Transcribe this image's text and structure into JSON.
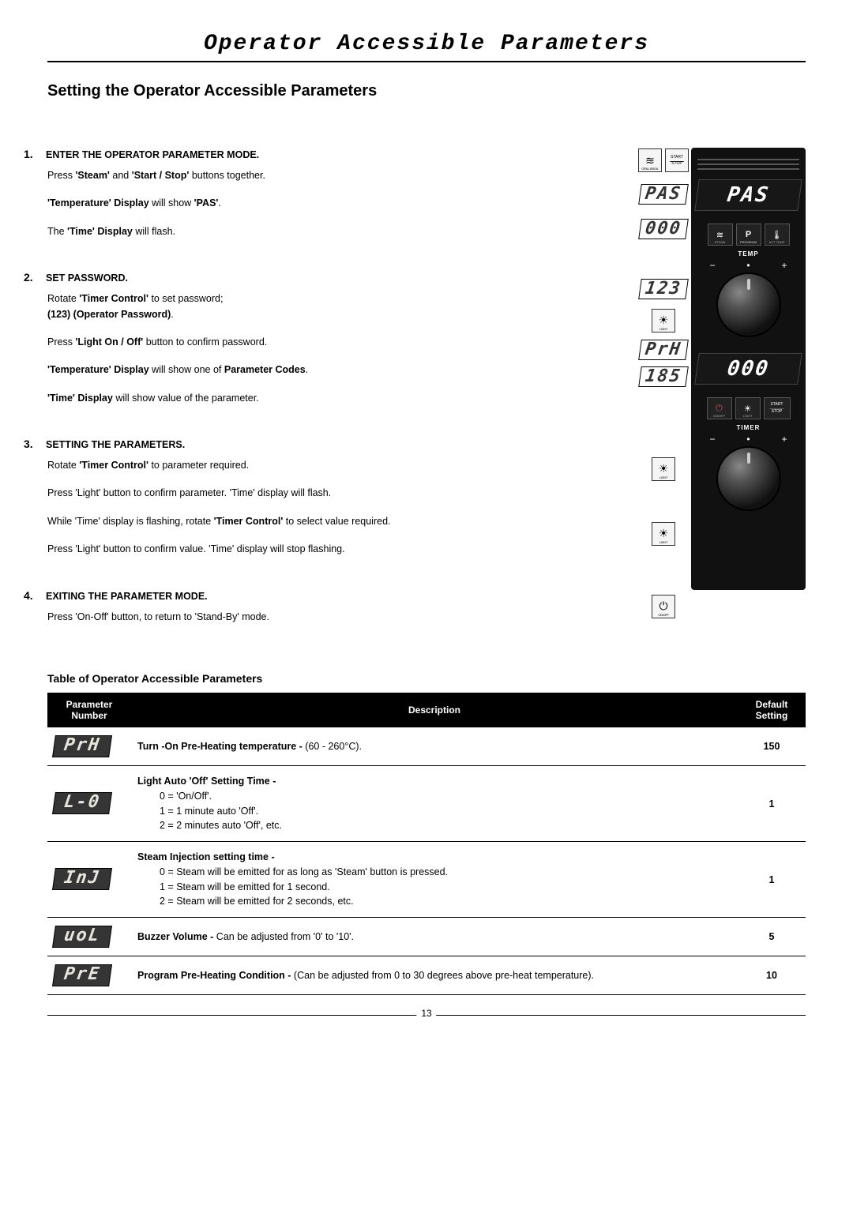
{
  "title": "Operator Accessible Parameters",
  "sectionTitle": "Setting the Operator Accessible Parameters",
  "steps": [
    {
      "num": "1.",
      "head": "ENTER THE OPERATOR PARAMETER MODE.",
      "lines": [
        "Press <b>'Steam'</b> and <b>'Start / Stop'</b> buttons together.",
        "<b>'Temperature' Display</b> will show <b>'PAS'</b>.",
        "The <b>'Time' Display</b> will flash."
      ]
    },
    {
      "num": "2.",
      "head": "SET PASSWORD.",
      "lines": [
        "Rotate <b>'Timer Control'</b> to set password;<br><b>(123) (Operator Password)</b>.",
        "Press <b>'Light On / Off'</b> button to confirm password.",
        "<b>'Temperature' Display</b> will show one of <b>Parameter Codes</b>.",
        "<b>'Time' Display</b> will show value of the parameter."
      ]
    },
    {
      "num": "3.",
      "head": "SETTING THE PARAMETERS.",
      "lines": [
        "Rotate <b>'Timer Control'</b> to parameter required.",
        "Press 'Light' button to confirm parameter.  'Time' display will flash.",
        "While 'Time' display is flashing, rotate <b>'Timer Control'</b> to select value required.",
        "Press 'Light' button to confirm value.  'Time' display will stop flashing."
      ]
    },
    {
      "num": "4.",
      "head": "EXITING THE PARAMETER MODE.",
      "lines": [
        "Press 'On-Off' button, to return to 'Stand-By' mode."
      ]
    }
  ],
  "sideIcons": {
    "grill": "GRILL BROIL",
    "startStopTop": "START",
    "startStopBot": "STOP",
    "pas": "PAS",
    "zeros": "000",
    "pw": "123",
    "light": "LIGHT",
    "prh": "PrH",
    "v185": "185",
    "onoff": "ON/OFF"
  },
  "panel": {
    "topDisplay": "PAS",
    "btn_steam": "STEAM",
    "btn_p": "P",
    "btn_program": "PROGRAM",
    "btn_temp_icon": "ACT TEMP",
    "tempLabel": "TEMP",
    "midDisplay": "000",
    "btn_onoff": "ON/OFF",
    "btn_light": "LIGHT",
    "btn_start": "START",
    "btn_stop": "STOP",
    "timerLabel": "TIMER"
  },
  "tableTitle": "Table of Operator Accessible Parameters",
  "tableHead": {
    "num": "Parameter Number",
    "desc": "Description",
    "def": "Default Setting"
  },
  "rows": [
    {
      "code": "PrH",
      "desc": "<b>Turn -On Pre-Heating temperature -</b> (60 - 260°C).",
      "def": "150"
    },
    {
      "code": "L-0",
      "desc": "<b>Light Auto 'Off' Setting Time -</b><span class=\"desc-sub\">0 = 'On/Off'.<br>1 = 1 minute auto 'Off'.<br>2 = 2 minutes auto 'Off', etc.</span>",
      "def": "1"
    },
    {
      "code": "InJ",
      "desc": "<b>Steam Injection setting time -</b><span class=\"desc-sub\">0 = Steam will be emitted for as long as 'Steam' button is pressed.<br>1 = Steam will be emitted for 1 second.<br>2 = Steam will be emitted for 2 seconds, etc.</span>",
      "def": "1"
    },
    {
      "code": "uoL",
      "desc": "<b>Buzzer Volume -</b> Can be adjusted from '0' to '10'.",
      "def": "5"
    },
    {
      "code": "PrE",
      "desc": "<b>Program Pre-Heating Condition -</b> (Can be adjusted from 0 to 30 degrees above pre-heat temperature).",
      "def": "10"
    }
  ],
  "pageNumber": "13"
}
